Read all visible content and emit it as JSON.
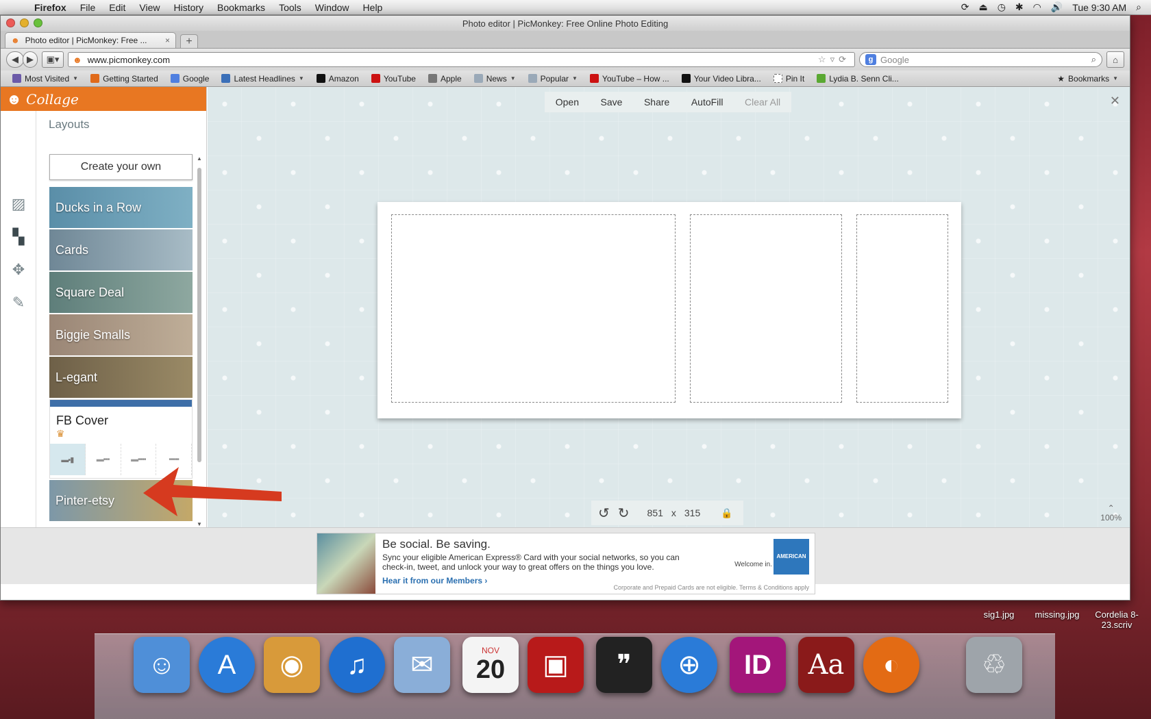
{
  "menubar": {
    "app": "Firefox",
    "items": [
      "File",
      "Edit",
      "View",
      "History",
      "Bookmarks",
      "Tools",
      "Window",
      "Help"
    ],
    "clock": "Tue 9:30 AM"
  },
  "window": {
    "title": "Photo editor | PicMonkey: Free Online Photo Editing",
    "tab_label": "Photo editor | PicMonkey: Free ...",
    "url": "www.picmonkey.com",
    "search_placeholder": "Google"
  },
  "bookmarks": {
    "items": [
      {
        "label": "Most Visited",
        "dropdown": true,
        "color": "#6b5aa8"
      },
      {
        "label": "Getting Started",
        "dropdown": false,
        "color": "#e06a1a"
      },
      {
        "label": "Google",
        "dropdown": false,
        "color": "#4f7fe0"
      },
      {
        "label": "Latest Headlines",
        "dropdown": true,
        "color": "#3b6fb8"
      },
      {
        "label": "Amazon",
        "dropdown": false,
        "color": "#111111"
      },
      {
        "label": "YouTube",
        "dropdown": false,
        "color": "#cc1111"
      },
      {
        "label": "Apple",
        "dropdown": false,
        "color": "#777777"
      },
      {
        "label": "News",
        "dropdown": true,
        "color": "#9aa9b8"
      },
      {
        "label": "Popular",
        "dropdown": true,
        "color": "#9aa9b8"
      },
      {
        "label": "YouTube – How ...",
        "dropdown": false,
        "color": "#cc1111"
      },
      {
        "label": "Your Video Libra...",
        "dropdown": false,
        "color": "#111111"
      },
      {
        "label": "Pin It",
        "dropdown": false,
        "color": "#ffffff"
      },
      {
        "label": "Lydia B. Senn Cli...",
        "dropdown": false,
        "color": "#5aa832"
      }
    ],
    "right": "Bookmarks"
  },
  "panel": {
    "header": "Collage",
    "section_title": "Layouts",
    "create_button": "Create your own",
    "layouts": [
      {
        "name": "Ducks in a Row",
        "color": "#5a8ea8"
      },
      {
        "name": "Cards",
        "color": "#7d96a6"
      },
      {
        "name": "Square Deal",
        "color": "#6f8c8a"
      },
      {
        "name": "Biggie Smalls",
        "color": "#a08e7c"
      },
      {
        "name": "L-egant",
        "color": "#7e7056"
      }
    ],
    "selected_layout": {
      "name": "FB Cover",
      "variants": [
        "▬▪▮",
        "▬▪▪▪",
        "▬▪▪▪▪",
        "▪▪▪▪▪"
      ]
    },
    "after_layouts": [
      {
        "name": "Pinter-etsy",
        "color": "#8aa0ad"
      }
    ],
    "rail_icons": [
      "image-icon",
      "layout-icon",
      "texture-icon",
      "palette-icon"
    ]
  },
  "toolbar": {
    "open": "Open",
    "save": "Save",
    "share": "Share",
    "autofill": "AutoFill",
    "clear_all": "Clear All"
  },
  "canvas": {
    "width_value": "851",
    "times": "x",
    "height_value": "315",
    "zoom": "100%"
  },
  "ad": {
    "headline": "Be social. Be saving.",
    "body": "Sync your eligible American Express® Card with your social networks, so you can check-in, tweet, and unlock your way to great offers on the things you love.",
    "link": "Hear it from our Members ›",
    "welcome": "Welcome in.",
    "fine_print": "Corporate and Prepaid Cards are not eligible. Terms & Conditions apply",
    "brand_mark": "AMERICAN EXPRESS"
  },
  "desktop": {
    "files": [
      {
        "name": "sig1.jpg"
      },
      {
        "name": "missing.jpg"
      },
      {
        "name": "Cordelia 8-23.scriv"
      }
    ],
    "calendar": {
      "month": "NOV",
      "day": "20"
    },
    "dock": [
      {
        "name": "Finder",
        "glyph": "☺",
        "color": "#4f8fd8"
      },
      {
        "name": "App Store",
        "glyph": "A",
        "color": "#2a7bd8"
      },
      {
        "name": "iPhoto",
        "glyph": "◉",
        "color": "#d89a3a"
      },
      {
        "name": "iTunes",
        "glyph": "♫",
        "color": "#1f6fd0"
      },
      {
        "name": "Mail",
        "glyph": "✉",
        "color": "#8aaed8"
      },
      {
        "name": "iCal",
        "glyph": "",
        "color": "#f4f4f4"
      },
      {
        "name": "Photo Booth",
        "glyph": "▣",
        "color": "#b81a1a"
      },
      {
        "name": "Scrivener",
        "glyph": "❞",
        "color": "#222222"
      },
      {
        "name": "Safari",
        "glyph": "⊕",
        "color": "#2a7bd8"
      },
      {
        "name": "InDesign",
        "glyph": "ID",
        "color": "#a3167a"
      },
      {
        "name": "Dictionary",
        "glyph": "Aa",
        "color": "#8a1a1a"
      },
      {
        "name": "Firefox",
        "glyph": "◐",
        "color": "#e36b14"
      },
      {
        "name": "Trash",
        "glyph": "♲",
        "color": "#9ea4aa"
      }
    ]
  }
}
